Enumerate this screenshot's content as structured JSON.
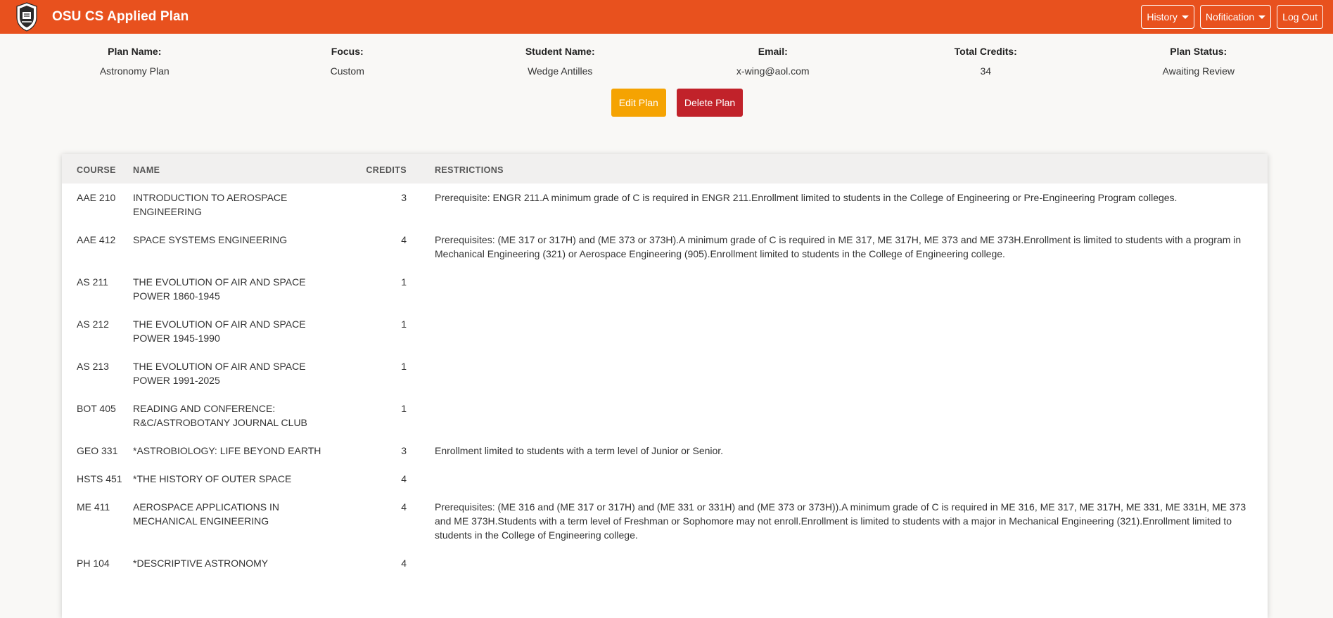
{
  "app": {
    "title": "OSU CS Applied Plan",
    "accent_color": "#e8511e",
    "logo_icon": "osu-seal-icon"
  },
  "nav": {
    "history_label": "History",
    "notification_label": "Nofitication",
    "logout_label": "Log Out"
  },
  "plan": {
    "fields": [
      {
        "label": "Plan Name:",
        "value": "Astronomy Plan"
      },
      {
        "label": "Focus:",
        "value": "Custom"
      },
      {
        "label": "Student Name:",
        "value": "Wedge Antilles"
      },
      {
        "label": "Email:",
        "value": "x-wing@aol.com"
      },
      {
        "label": "Total Credits:",
        "value": "34"
      },
      {
        "label": "Plan Status:",
        "value": "Awaiting Review"
      }
    ],
    "edit_label": "Edit Plan",
    "delete_label": "Delete Plan",
    "edit_color": "#f5a302",
    "delete_color": "#c1222a"
  },
  "table": {
    "headers": [
      "Course",
      "Name",
      "Credits",
      "Restrictions"
    ],
    "rows": [
      {
        "course": "AAE 210",
        "name": "INTRODUCTION TO AEROSPACE ENGINEERING",
        "credits": "3",
        "restrictions": "Prerequisite: ENGR 211.A minimum grade of C is required in ENGR 211.Enrollment limited to students in the College of Engineering or Pre-Engineering Program colleges."
      },
      {
        "course": "AAE 412",
        "name": "SPACE SYSTEMS ENGINEERING",
        "credits": "4",
        "restrictions": "Prerequisites: (ME 317 or 317H) and (ME 373 or 373H).A minimum grade of C is required in ME 317, ME 317H, ME 373 and ME 373H.Enrollment is limited to students with a program in Mechanical Engineering (321) or Aerospace Engineering (905).Enrollment limited to students in the College of Engineering college."
      },
      {
        "course": "AS 211",
        "name": "THE EVOLUTION OF AIR AND SPACE POWER 1860-1945",
        "credits": "1",
        "restrictions": ""
      },
      {
        "course": "AS 212",
        "name": "THE EVOLUTION OF AIR AND SPACE POWER 1945-1990",
        "credits": "1",
        "restrictions": ""
      },
      {
        "course": "AS 213",
        "name": "THE EVOLUTION OF AIR AND SPACE POWER 1991-2025",
        "credits": "1",
        "restrictions": ""
      },
      {
        "course": "BOT 405",
        "name": "READING AND CONFERENCE: R&C/ASTROBOTANY JOURNAL CLUB",
        "credits": "1",
        "restrictions": ""
      },
      {
        "course": "GEO 331",
        "name": "*ASTROBIOLOGY: LIFE BEYOND EARTH",
        "credits": "3",
        "restrictions": "Enrollment limited to students with a term level of Junior or Senior."
      },
      {
        "course": "HSTS 451",
        "name": "*THE HISTORY OF OUTER SPACE",
        "credits": "4",
        "restrictions": ""
      },
      {
        "course": "ME 411",
        "name": "AEROSPACE APPLICATIONS IN MECHANICAL ENGINEERING",
        "credits": "4",
        "restrictions": "Prerequisites: (ME 316 and (ME 317 or 317H) and (ME 331 or 331H) and (ME 373 or 373H)).A minimum grade of C is required in ME 316, ME 317, ME 317H, ME 331, ME 331H, ME 373 and ME 373H.Students with a term level of Freshman or Sophomore may not enroll.Enrollment is limited to students with a major in Mechanical Engineering (321).Enrollment limited to students in the College of Engineering college."
      },
      {
        "course": "PH 104",
        "name": "*DESCRIPTIVE ASTRONOMY",
        "credits": "4",
        "restrictions": ""
      }
    ]
  }
}
